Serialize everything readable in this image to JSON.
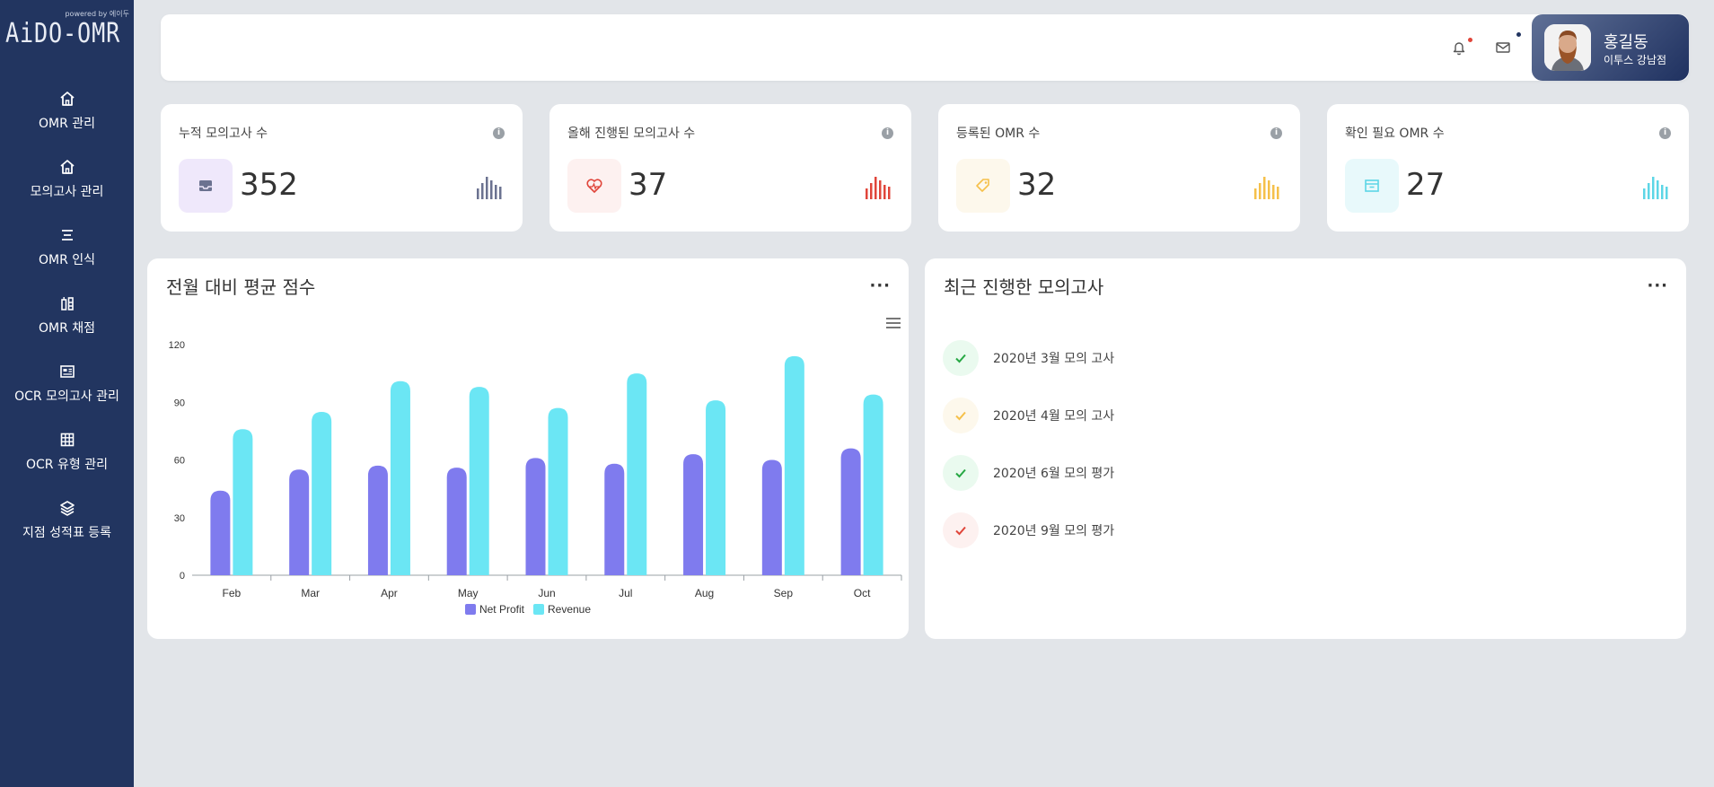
{
  "brand": {
    "logo_text": "AiDO-OMR",
    "logo_small": "powered by 에이두"
  },
  "sidebar": {
    "items": [
      {
        "label": "OMR 관리",
        "icon": "home-icon"
      },
      {
        "label": "모의고사 관리",
        "icon": "home-icon"
      },
      {
        "label": "OMR 인식",
        "icon": "list-icon"
      },
      {
        "label": "OMR 채점",
        "icon": "score-icon"
      },
      {
        "label": "OCR 모의고사 관리",
        "icon": "newspaper-icon"
      },
      {
        "label": "OCR 유형 관리",
        "icon": "grid-icon"
      },
      {
        "label": "지점 성적표 등록",
        "icon": "layers-icon"
      }
    ]
  },
  "header": {
    "icons": [
      "bell-icon",
      "mail-icon"
    ],
    "user": {
      "name": "홍길동",
      "branch": "이투스 강남점"
    }
  },
  "stats": [
    {
      "title": "누적 모의고사 수",
      "value": "352",
      "icon": "inbox-icon",
      "color": "#6b7290",
      "bg": "#efe8fb"
    },
    {
      "title": "올해 진행된 모의고사 수",
      "value": "37",
      "icon": "heart-rate-icon",
      "color": "#e0453a",
      "bg": "#fdf1f0"
    },
    {
      "title": "등록된 OMR 수",
      "value": "32",
      "icon": "tag-icon",
      "color": "#f5c04a",
      "bg": "#fdf8ec"
    },
    {
      "title": "확인 필요 OMR 수",
      "value": "27",
      "icon": "archive-icon",
      "color": "#5cd6e6",
      "bg": "#e8f9fb"
    }
  ],
  "chart_panel": {
    "title": "전월 대비 평균 점수",
    "more": "···"
  },
  "recent_panel": {
    "title": "최근 진행한 모의고사",
    "more": "···",
    "items": [
      {
        "label": "2020년 3월 모의 고사",
        "color": "#27a844",
        "bg": "#eafaef"
      },
      {
        "label": "2020년 4월 모의 고사",
        "color": "#f5c04a",
        "bg": "#fdf8ec"
      },
      {
        "label": "2020년 6월 모의 평가",
        "color": "#27a844",
        "bg": "#eafaef"
      },
      {
        "label": "2020년 9월 모의 평가",
        "color": "#e0453a",
        "bg": "#fdf1f0"
      }
    ]
  },
  "chart_data": {
    "type": "bar",
    "categories": [
      "Feb",
      "Mar",
      "Apr",
      "May",
      "Jun",
      "Jul",
      "Aug",
      "Sep",
      "Oct"
    ],
    "series": [
      {
        "name": "Net Profit",
        "color": "#7f7bee",
        "values": [
          44,
          55,
          57,
          56,
          61,
          58,
          63,
          60,
          66
        ]
      },
      {
        "name": "Revenue",
        "color": "#6be6f4",
        "values": [
          76,
          85,
          101,
          98,
          87,
          105,
          91,
          114,
          94
        ]
      }
    ],
    "ylim": [
      0,
      120
    ],
    "yticks": [
      0,
      30,
      60,
      90,
      120
    ],
    "grid": false,
    "legend": "bottom-center"
  }
}
